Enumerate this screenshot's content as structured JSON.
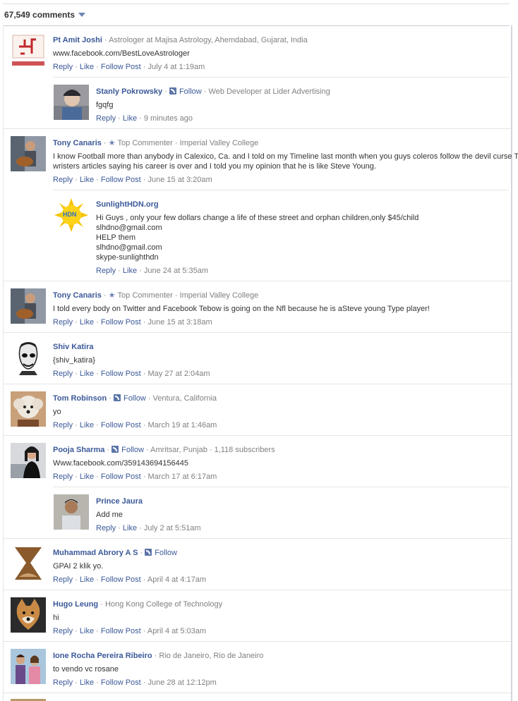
{
  "header": {
    "comment_count": "67,549 comments"
  },
  "actions": {
    "reply": "Reply",
    "like": "Like",
    "follow_post": "Follow Post",
    "follow": "Follow",
    "dot": " · "
  },
  "comments": [
    {
      "name": "Pt Amit Joshi",
      "meta": "Astrologer at Majisa Astrology, Ahemdabad, Gujarat, India",
      "text": [
        "www.facebook.com/BestLoveAstrologer"
      ],
      "time": "July 4 at 1:19am"
    },
    {
      "name": "Stanly Pokrowsky",
      "meta": "Web Developer at Lider Advertising",
      "text": [
        "fgqfg"
      ],
      "time": "9 minutes ago"
    },
    {
      "name": "Tony Canaris",
      "badge": "Top Commenter",
      "meta": "Imperial Valley College",
      "text": [
        "I know Football more than anybody in Calexico, Ca. and I told on my Timeline last month when you guys coleros follow the devil curse T",
        "wristers articles saying his career is over and I told you my opinion that he is like Steve Young."
      ],
      "time": "June 15 at 3:20am"
    },
    {
      "name": "SunlightHDN.org",
      "avatar_text": "HDN",
      "text": [
        "Hi Guys , only your few dollars change a life of these street and orphan children,only $45/child",
        "slhdno@gmail.com",
        "HELP them",
        "slhdno@gmail.com",
        "skype-sunlighthdn"
      ],
      "time": "June 24 at 5:35am"
    },
    {
      "name": "Tony Canaris",
      "badge": "Top Commenter",
      "meta": "Imperial Valley College",
      "text": [
        "I told every body on Twitter and Facebook Tebow is going on the Nfl because he is aSteve young Type player!"
      ],
      "time": "June 15 at 3:18am"
    },
    {
      "name": "Shiv Katira",
      "text": [
        "{shiv_katira}"
      ],
      "time": "May 27 at 2:04am"
    },
    {
      "name": "Tom Robinson",
      "meta": "Ventura, California",
      "text": [
        "yo"
      ],
      "time": "March 19 at 1:46am"
    },
    {
      "name": "Pooja Sharma",
      "meta": "Amritsar, Punjab · 1,118 subscribers",
      "text": [
        "Www.facebook.com/359143694156445"
      ],
      "time": "March 17 at 6:17am"
    },
    {
      "name": "Prince Jaura",
      "text": [
        "Add me"
      ],
      "time": "July 2 at 5:51am"
    },
    {
      "name": "Muhammad Abrory A S",
      "text": [
        "GPAI 2 klik yo."
      ],
      "time": "April 4 at 4:17am"
    },
    {
      "name": "Hugo Leung",
      "meta": "Hong Kong College of Technology",
      "text": [
        "hi"
      ],
      "time": "April 4 at 5:03am"
    },
    {
      "name": "Ione Rocha Pereira Ribeiro",
      "meta": "Rio de Janeiro, Rio de Janeiro",
      "text": [
        "to vendo vc rosane"
      ],
      "time": "June 28 at 12:12pm"
    }
  ]
}
